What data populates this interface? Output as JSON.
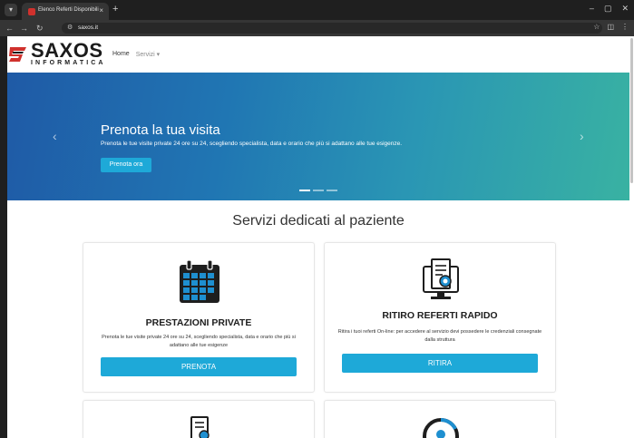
{
  "browser": {
    "tab_title": "Elenco Referti Disponibili",
    "tab_close": "×",
    "new_tab": "+",
    "url": "saxos.it",
    "window_controls": [
      "–",
      "▢",
      "✕"
    ]
  },
  "site": {
    "logo_name": "SAXOS",
    "logo_subtitle": "INFORMATICA",
    "nav": {
      "home": "Home",
      "servizi": "Servizi ▾"
    }
  },
  "hero": {
    "title": "Prenota la tua visita",
    "subtitle": "Prenota le tue visite private 24 ore su 24, scegliendo specialista, data e orario che più si adattano alle tue esigenze.",
    "cta_label": "Prenota ora",
    "prev_arrow": "‹",
    "next_arrow": "›"
  },
  "services": {
    "title": "Servizi dedicati al paziente",
    "cards": [
      {
        "title": "PRESTAZIONI PRIVATE",
        "description": "Prenota le tue visite private 24 ore su 24, scegliendo specialista, data e orario che più si adattano alle tue esigenze",
        "button": "PRENOTA",
        "icon": "calendar-icon"
      },
      {
        "title": "RITIRO REFERTI RAPIDO",
        "description": "Ritira i tuoi referti On-line: per accedere al servizio devi possedere le credenziali consegnate dalla struttura",
        "button": "RITIRA",
        "icon": "monitor-document-icon"
      }
    ]
  },
  "colors": {
    "accent": "#1ea9d8",
    "hero_start": "#1f5aa6",
    "hero_end": "#39b2a2",
    "logo_red": "#d0312d"
  }
}
